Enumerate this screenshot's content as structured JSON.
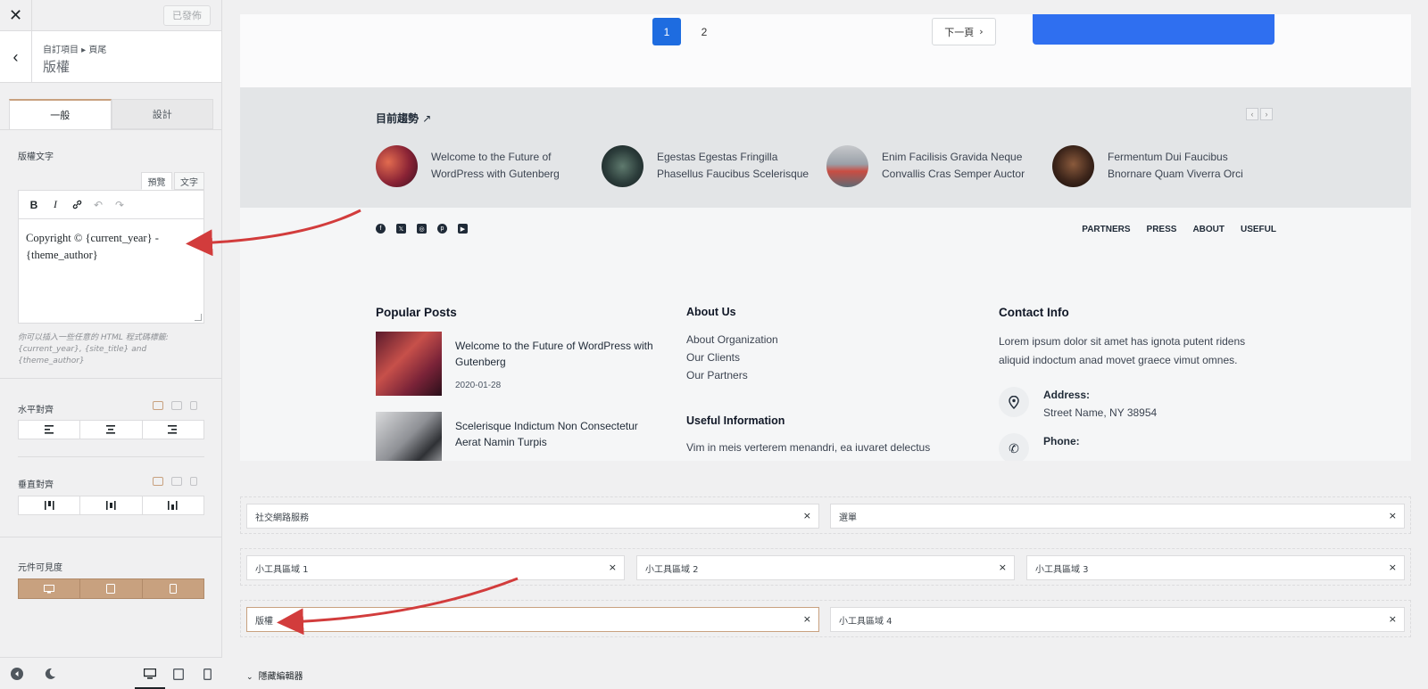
{
  "panel": {
    "close_icon": "close-icon",
    "publish_label": "已發佈",
    "breadcrumb": "自訂項目 ▸ 頁尾",
    "title": "版權",
    "tabs": [
      "一般",
      "設計"
    ],
    "copyright_label": "版權文字",
    "mode_tabs": [
      "預覽",
      "文字"
    ],
    "editor_text": "Copyright © {current_year} - {theme_author}",
    "hint": "你可以插入一些任意的 HTML 程式碼標籤: {current_year}, {site_title} and {theme_author}",
    "halign_label": "水平對齊",
    "valign_label": "垂直對齊",
    "visibility_label": "元件可見度"
  },
  "preview": {
    "pagination": {
      "current": "1",
      "next_page": "2",
      "next_label": "下一頁"
    },
    "trending": {
      "title": "目前趨勢",
      "items": [
        {
          "line1": "Welcome to the Future of",
          "line2": "WordPress with Gutenberg"
        },
        {
          "line1": "Egestas Egestas Fringilla",
          "line2": "Phasellus Faucibus Scelerisque"
        },
        {
          "line1": "Enim Facilisis Gravida Neque",
          "line2": "Convallis Cras Semper Auctor"
        },
        {
          "line1": "Fermentum Dui Faucibus",
          "line2": "Bnornare Quam Viverra Orci"
        }
      ]
    },
    "footer_nav": [
      "PARTNERS",
      "PRESS",
      "ABOUT",
      "USEFUL"
    ],
    "popular": {
      "title": "Popular Posts",
      "posts": [
        {
          "title": "Welcome to the Future of WordPress with Gutenberg",
          "date": "2020-01-28"
        },
        {
          "title": "Scelerisque Indictum Non Consectetur Aerat Namin Turpis",
          "date": ""
        }
      ]
    },
    "about": {
      "title": "About Us",
      "links": [
        "About Organization",
        "Our Clients",
        "Our Partners"
      ],
      "useful_title": "Useful Information",
      "useful_text": "Vim in meis verterem menandri, ea iuvaret delectus"
    },
    "contact": {
      "title": "Contact Info",
      "text": "Lorem ipsum dolor sit amet has ignota putent ridens aliquid indoctum anad movet graece vimut omnes.",
      "address_label": "Address:",
      "address_value": "Street Name, NY 38954",
      "phone_label": "Phone:"
    }
  },
  "builder": {
    "row1": [
      "社交網路服務",
      "選單"
    ],
    "row2": [
      "小工具區域 1",
      "小工具區域 2",
      "小工具區域 3"
    ],
    "row3": [
      "版權",
      "小工具區域 4"
    ],
    "hide_editor": "隱藏編輯器"
  },
  "colors": {
    "accent": "#c8a17f",
    "primary_blue": "#1e6ce0",
    "annotation_red": "#d23c3c"
  }
}
